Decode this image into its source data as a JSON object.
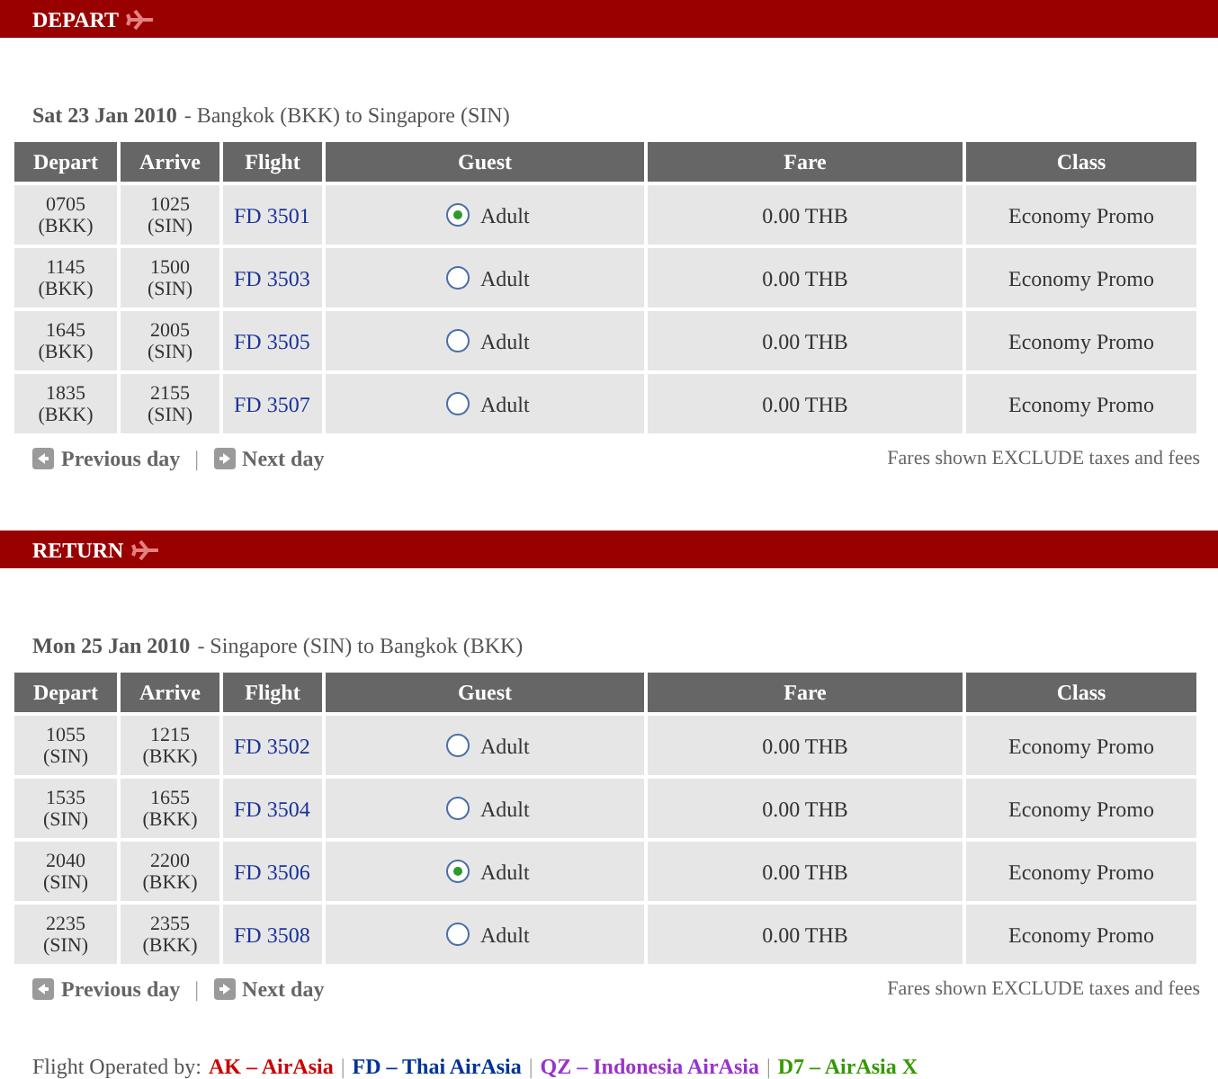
{
  "sections": [
    {
      "title": "DEPART",
      "date": "Sat 23 Jan 2010",
      "route": "- Bangkok (BKK) to Singapore (SIN)",
      "columns": [
        "Depart",
        "Arrive",
        "Flight",
        "Guest",
        "Fare",
        "Class"
      ],
      "rows": [
        {
          "depart": "0705",
          "depart_code": "(BKK)",
          "arrive": "1025",
          "arrive_code": "(SIN)",
          "flight": "FD 3501",
          "guest": "Adult",
          "selected": true,
          "fare": "0.00 THB",
          "class": "Economy Promo"
        },
        {
          "depart": "1145",
          "depart_code": "(BKK)",
          "arrive": "1500",
          "arrive_code": "(SIN)",
          "flight": "FD 3503",
          "guest": "Adult",
          "selected": false,
          "fare": "0.00 THB",
          "class": "Economy Promo"
        },
        {
          "depart": "1645",
          "depart_code": "(BKK)",
          "arrive": "2005",
          "arrive_code": "(SIN)",
          "flight": "FD 3505",
          "guest": "Adult",
          "selected": false,
          "fare": "0.00 THB",
          "class": "Economy Promo"
        },
        {
          "depart": "1835",
          "depart_code": "(BKK)",
          "arrive": "2155",
          "arrive_code": "(SIN)",
          "flight": "FD 3507",
          "guest": "Adult",
          "selected": false,
          "fare": "0.00 THB",
          "class": "Economy Promo"
        }
      ],
      "prev": "Previous day",
      "nav_separator": "|",
      "next": "Next day",
      "note": "Fares shown EXCLUDE taxes and fees"
    },
    {
      "title": "RETURN",
      "date": "Mon 25 Jan 2010",
      "route": "- Singapore (SIN) to Bangkok (BKK)",
      "columns": [
        "Depart",
        "Arrive",
        "Flight",
        "Guest",
        "Fare",
        "Class"
      ],
      "rows": [
        {
          "depart": "1055",
          "depart_code": "(SIN)",
          "arrive": "1215",
          "arrive_code": "(BKK)",
          "flight": "FD 3502",
          "guest": "Adult",
          "selected": false,
          "fare": "0.00 THB",
          "class": "Economy Promo"
        },
        {
          "depart": "1535",
          "depart_code": "(SIN)",
          "arrive": "1655",
          "arrive_code": "(BKK)",
          "flight": "FD 3504",
          "guest": "Adult",
          "selected": false,
          "fare": "0.00 THB",
          "class": "Economy Promo"
        },
        {
          "depart": "2040",
          "depart_code": "(SIN)",
          "arrive": "2200",
          "arrive_code": "(BKK)",
          "flight": "FD 3506",
          "guest": "Adult",
          "selected": true,
          "fare": "0.00 THB",
          "class": "Economy Promo"
        },
        {
          "depart": "2235",
          "depart_code": "(SIN)",
          "arrive": "2355",
          "arrive_code": "(BKK)",
          "flight": "FD 3508",
          "guest": "Adult",
          "selected": false,
          "fare": "0.00 THB",
          "class": "Economy Promo"
        }
      ],
      "prev": "Previous day",
      "nav_separator": "|",
      "next": "Next day",
      "note": "Fares shown EXCLUDE taxes and fees"
    }
  ],
  "footer": {
    "label": "Flight Operated by:",
    "operators": [
      {
        "text": "AK – AirAsia",
        "color": "#cc0000"
      },
      {
        "separator": "|",
        "text": "FD – Thai AirAsia",
        "color": "#003399"
      },
      {
        "separator": "|",
        "text": "QZ – Indonesia AirAsia",
        "color": "#9933cc"
      },
      {
        "separator": "|",
        "text": "D7 – AirAsia X",
        "color": "#339900"
      }
    ]
  }
}
